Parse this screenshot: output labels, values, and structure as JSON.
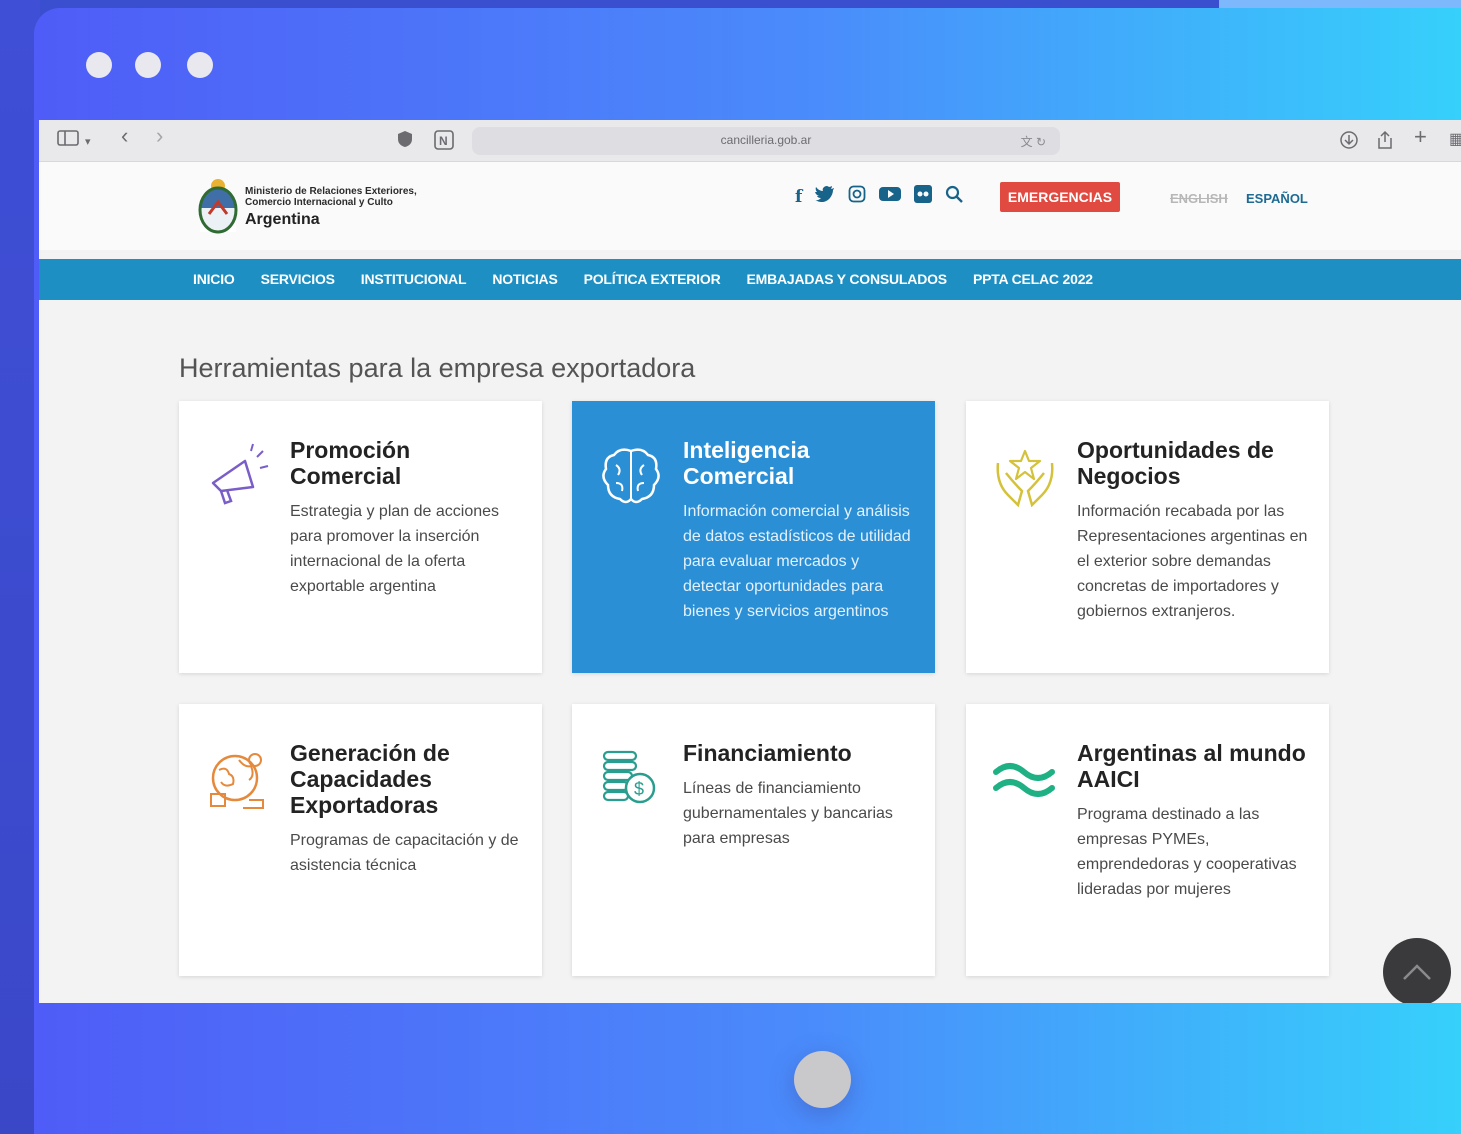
{
  "browser": {
    "url": "cancilleria.gob.ar",
    "nav_icons": {
      "sidebar": "sidebar-icon",
      "back": "‹",
      "forward": "›"
    }
  },
  "site": {
    "logo_line1": "Ministerio de Relaciones Exteriores,",
    "logo_line2": "Comercio Internacional y Culto",
    "logo_country": "Argentina",
    "emergencias": "EMERGENCIAS",
    "lang_en": "ENGLISH",
    "lang_es": "ESPAÑOL",
    "accent_color": "#1d8fc2",
    "emergency_color": "#e04a40"
  },
  "nav": {
    "items": [
      "INICIO",
      "SERVICIOS",
      "INSTITUCIONAL",
      "NOTICIAS",
      "POLÍTICA EXTERIOR",
      "EMBAJADAS Y CONSULADOS",
      "PPTA CELAC 2022"
    ]
  },
  "main": {
    "section_title": "Herramientas para la empresa exportadora",
    "cards": [
      {
        "title_line1": "Promoción",
        "title_line2": "Comercial",
        "description": "Estrategia y plan de acciones para promover la inserción internacional de la oferta exportable argentina",
        "icon": "megaphone-icon",
        "active": false
      },
      {
        "title_line1": "Inteligencia",
        "title_line2": "Comercial",
        "description": "Información comercial y análisis de datos estadísticos de utilidad para evaluar mercados y detectar oportunidades para bienes y servicios argentinos",
        "icon": "brain-icon",
        "active": true
      },
      {
        "title_line1": "Oportunidades de",
        "title_line2": "Negocios",
        "description": "Información recabada por las Representaciones argentinas en el exterior sobre demandas concretas de importadores y gobiernos extranjeros.",
        "icon": "hands-star-icon",
        "active": false
      },
      {
        "title_line1": "Generación de",
        "title_line2": "Capacidades",
        "title_line3": "Exportadoras",
        "description": "Programas de capacitación y de asistencia técnica",
        "icon": "globe-gear-icon",
        "active": false
      },
      {
        "title_line1": "Financiamiento",
        "description": "Líneas de financiamiento gubernamentales y bancarias para empresas",
        "icon": "coins-icon",
        "active": false
      },
      {
        "title_line1": "Argentinas al mundo",
        "title_line2": "AAICI",
        "description": "Programa destinado a las empresas PYMEs, emprendedoras y cooperativas lideradas por mujeres",
        "icon": "waves-icon",
        "active": false
      }
    ]
  }
}
